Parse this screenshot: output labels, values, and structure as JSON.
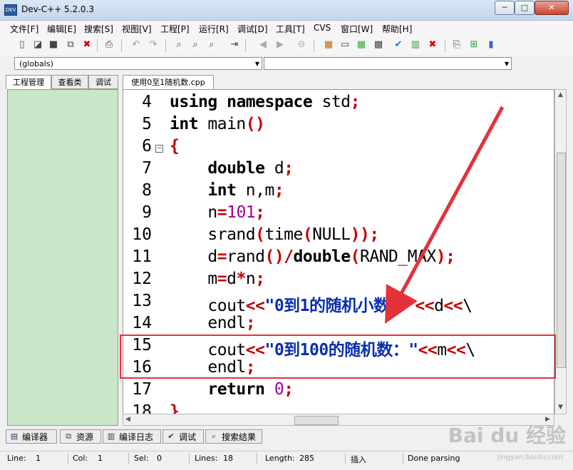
{
  "window": {
    "title": "Dev-C++ 5.2.0.3",
    "icon_label": "DEV"
  },
  "window_controls": {
    "minimize": "─",
    "maximize": "□",
    "close": "✕"
  },
  "menu": [
    "文件[F]",
    "编辑[E]",
    "搜索[S]",
    "视图[V]",
    "工程[P]",
    "运行[R]",
    "调试[D]",
    "工具[T]",
    "CVS",
    "窗口[W]",
    "帮助[H]"
  ],
  "scope": {
    "left_value": "(globals)",
    "right_value": ""
  },
  "left_tabs": [
    "工程管理",
    "查看类",
    "调试"
  ],
  "file_tab": "使用0至1随机数.cpp",
  "editor": {
    "line_numbers": [
      "4",
      "5",
      "6",
      "7",
      "8",
      "9",
      "10",
      "11",
      "12",
      "13",
      "14",
      "15",
      "16",
      "17",
      "18"
    ],
    "fold_marker": "−"
  },
  "bottom_tabs": [
    "编译器",
    "资源",
    "编译日志",
    "调试",
    "搜索结果"
  ],
  "status": {
    "line_label": "Line:",
    "line_value": "1",
    "col_label": "Col:",
    "col_value": "1",
    "sel_label": "Sel:",
    "sel_value": "0",
    "lines_label": "Lines:",
    "lines_value": "18",
    "length_label": "Length:",
    "length_value": "285",
    "mode": "插入",
    "parse_state": "Done parsing"
  },
  "watermark": {
    "text": "Bai du 经验",
    "sub": "jingyan.baidu.com"
  },
  "colors": {
    "highlight_box": "#e3323a",
    "left_panel": "#c9e6c9",
    "keyword": "#000000",
    "number": "#a000a0",
    "operator": "#c00000",
    "string": "#0a2fb0"
  }
}
